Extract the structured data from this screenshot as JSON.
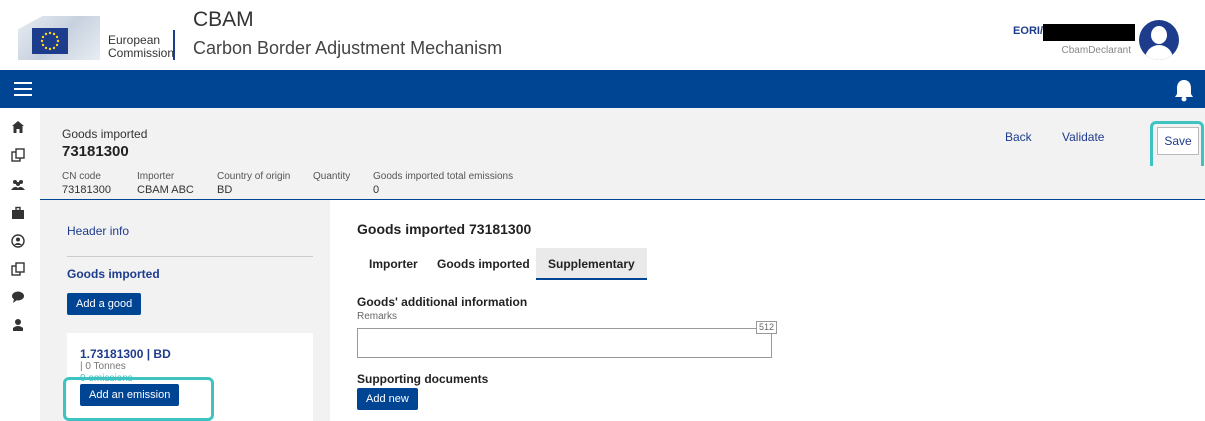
{
  "header": {
    "org_line1": "European",
    "org_line2": "Commission",
    "app_title": "CBAM",
    "app_subtitle": "Carbon Border Adjustment Mechanism",
    "eori_label": "EORI/",
    "user_role": "CbamDeclarant"
  },
  "page": {
    "label": "Goods imported",
    "code": "73181300",
    "actions": {
      "back": "Back",
      "validate": "Validate",
      "save": "Save"
    }
  },
  "summary": [
    {
      "label": "CN code",
      "value": "73181300"
    },
    {
      "label": "Importer",
      "value": "CBAM ABC"
    },
    {
      "label": "Country of origin",
      "value": "BD"
    },
    {
      "label": "Quantity",
      "value": ""
    },
    {
      "label": "Goods imported total emissions",
      "value": "0"
    }
  ],
  "left": {
    "header_info": "Header info",
    "goods_section": "Goods imported",
    "add_good": "Add a good",
    "good": {
      "title": "1.73181300 | BD",
      "qty": "| 0 Tonnes",
      "emissions": "0 emissions",
      "add_emission": "Add an emission"
    }
  },
  "main": {
    "title": "Goods imported 73181300",
    "tabs": [
      "Importer",
      "Goods imported",
      "Supplementary"
    ],
    "additional_info_title": "Goods' additional information",
    "remarks_label": "Remarks",
    "remarks_value": "",
    "char_count": "512",
    "supporting_docs_title": "Supporting documents",
    "add_new": "Add new"
  },
  "colors": {
    "brand": "#004494",
    "highlight": "#3fc2c2",
    "link": "#1e3c8c"
  }
}
